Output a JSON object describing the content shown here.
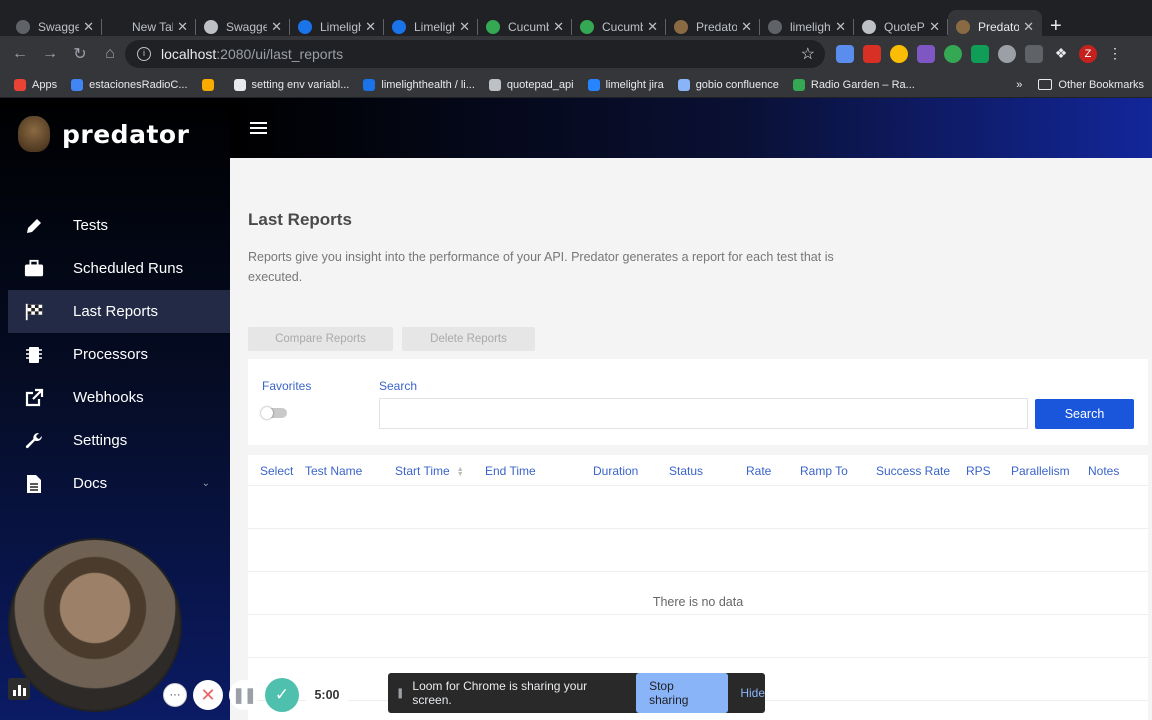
{
  "browser": {
    "tabs": [
      {
        "title": "Swagger",
        "favicon_color": "#5f6368"
      },
      {
        "title": "New Tab",
        "favicon_color": ""
      },
      {
        "title": "Swagger",
        "favicon_color": "#bdc1c6"
      },
      {
        "title": "Limelight",
        "favicon_color": "#1a73e8"
      },
      {
        "title": "Limelight",
        "favicon_color": "#1a73e8"
      },
      {
        "title": "Cucumber",
        "favicon_color": "#34a853"
      },
      {
        "title": "Cucumber",
        "favicon_color": "#34a853"
      },
      {
        "title": "Predator",
        "favicon_color": "#8a6a42"
      },
      {
        "title": "limelight",
        "favicon_color": "#5f6368"
      },
      {
        "title": "QuoteP",
        "favicon_color": "#bdc1c6"
      },
      {
        "title": "Predator",
        "favicon_color": "#8a6a42",
        "active": true
      }
    ],
    "url_host": "localhost",
    "url_path": ":2080/ui/last_reports",
    "bookmarks": [
      {
        "label": "Apps",
        "icon_color": "#ea4335"
      },
      {
        "label": "estacionesRadioC...",
        "icon_color": "#4285f4"
      },
      {
        "label": "",
        "icon_color": "#f9ab00"
      },
      {
        "label": "setting env variabl...",
        "icon_color": "#e8eaed"
      },
      {
        "label": "limelighthealth / li...",
        "icon_color": "#1a73e8"
      },
      {
        "label": "quotepad_api",
        "icon_color": "#bdc1c6"
      },
      {
        "label": "limelight jira",
        "icon_color": "#2684ff"
      },
      {
        "label": "gobio confluence",
        "icon_color": "#8ab4f8"
      },
      {
        "label": "Radio Garden – Ra...",
        "icon_color": "#34a853"
      }
    ],
    "other_bookmarks": "Other Bookmarks",
    "more_bookmarks": "»",
    "profile_initial": "Z"
  },
  "sidebar": {
    "logo": "predator",
    "items": [
      {
        "label": "Tests",
        "icon": "pencil-icon"
      },
      {
        "label": "Scheduled Runs",
        "icon": "briefcase-icon"
      },
      {
        "label": "Last Reports",
        "icon": "checkered-flag-icon",
        "active": true
      },
      {
        "label": "Processors",
        "icon": "chip-icon"
      },
      {
        "label": "Webhooks",
        "icon": "external-link-icon"
      },
      {
        "label": "Settings",
        "icon": "wrench-icon"
      },
      {
        "label": "Docs",
        "icon": "document-icon",
        "chevron": "⌄"
      }
    ]
  },
  "page": {
    "title": "Last Reports",
    "description": "Reports give you insight into the performance of your API. Predator generates a report for each test that is executed.",
    "compare_label": "Compare Reports",
    "delete_label": "Delete Reports",
    "favorites_label": "Favorites",
    "search_label": "Search",
    "search_button": "Search",
    "columns": [
      "Select",
      "Test Name",
      "Start Time",
      "End Time",
      "Duration",
      "Status",
      "Rate",
      "Ramp To",
      "Success Rate",
      "RPS",
      "Parallelism",
      "Notes"
    ],
    "empty_text": "There is no data"
  },
  "recorder": {
    "timer": "5:00",
    "more_label": "···",
    "share_text": "Loom for Chrome is sharing your screen.",
    "stop_label": "Stop sharing",
    "hide_label": "Hide",
    "colors": {
      "accent": "#4fbfae",
      "close": "#e96363"
    }
  }
}
